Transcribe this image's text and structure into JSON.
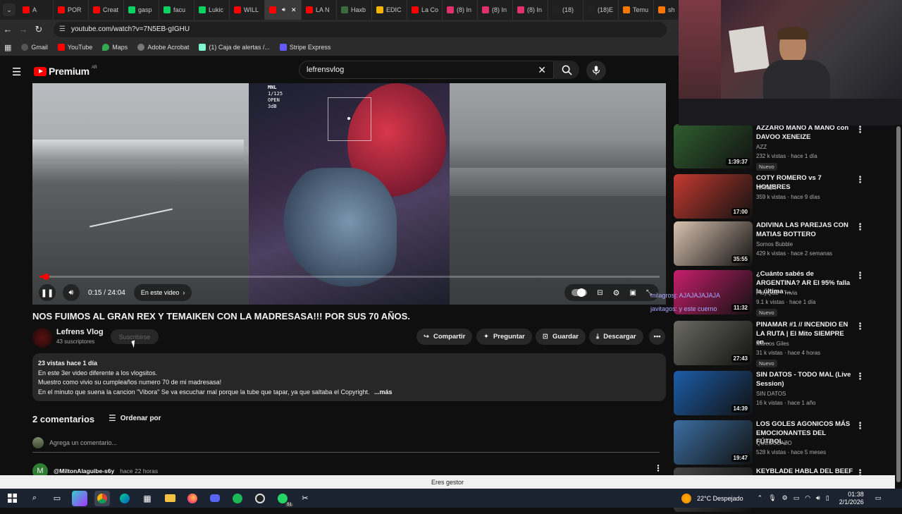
{
  "tabs": [
    {
      "label": "A",
      "color": "#ff0000"
    },
    {
      "label": "POR",
      "color": "#ff0000"
    },
    {
      "label": "Creat",
      "color": "#ff0000"
    },
    {
      "label": "gasp",
      "color": "#0bd160"
    },
    {
      "label": "facu",
      "color": "#0bd160"
    },
    {
      "label": "Lukic",
      "color": "#0bd160"
    },
    {
      "label": "WILL",
      "color": "#ff0000"
    },
    {
      "label": "",
      "color": "#ff0000",
      "active": true
    },
    {
      "label": "LA N",
      "color": "#ff0000"
    },
    {
      "label": "Haxb",
      "color": "#3a6b3a"
    },
    {
      "label": "EDIC",
      "color": "#f4b400"
    },
    {
      "label": "La Co",
      "color": "#ff0000"
    },
    {
      "label": "(8) In",
      "color": "#e1306c"
    },
    {
      "label": "(8) In",
      "color": "#e1306c"
    },
    {
      "label": "(8) In",
      "color": "#e1306c"
    },
    {
      "label": "(18)",
      "color": "#222222"
    },
    {
      "label": "(18)E",
      "color": "#222222"
    },
    {
      "label": "Temu",
      "color": "#fb7701"
    },
    {
      "label": "sh",
      "color": "#fb7701"
    }
  ],
  "url": "youtube.com/watch?v=7N5EB-gIGHU",
  "bookmarks": [
    "Gmail",
    "YouTube",
    "Maps",
    "Adobe Acrobat",
    "(1) Caja de alertas /...",
    "Stripe Express"
  ],
  "header": {
    "logo_text": "Premium",
    "region": "AR",
    "search_value": "lefrensvlog"
  },
  "video": {
    "time": "0:15 / 24:04",
    "chapter_chip": "En este video",
    "progress": 0.0104,
    "osd_lines": [
      "MNL",
      "1/125",
      "OPEN",
      "3dB"
    ]
  },
  "title": "NOS FUIMOS AL GRAN REX Y TEMAIKEN CON LA MADRESASA!!! POR SUS 70 AÑOS.",
  "channel": {
    "name": "Lefrens Vlog",
    "subs": "43 suscriptores",
    "subscribe": "Suscribirse"
  },
  "actions": {
    "share": "Compartir",
    "ask": "Preguntar",
    "save": "Guardar",
    "download": "Descargar"
  },
  "description": {
    "stats": "23 vistas  hace 1 día",
    "line1": "En este 3er video diferente a los vlogsitos.",
    "line2": "Muestro como vivio su cumpleaños numero 70 de mi madresasa!",
    "line3": "En el minuto que suena la cancion \"Vibora\" Se va escuchar mal porque la tube que tapar, ya que saltaba el Copyright.",
    "more": "...más"
  },
  "comments": {
    "count": "2 comentarios",
    "sort": "Ordenar por",
    "placeholder": "Agrega un comentario...",
    "first_user": "@MiltonAlaguibe-s6y",
    "first_time": "hace 22 horas",
    "first_avatar": "M"
  },
  "recommendations": [
    {
      "title": "AZZARO MANO A MANO con DAVOO XENEIZE",
      "channel": "AZZ",
      "meta": "232 k vistas · hace 1 día",
      "duration": "1:39:37",
      "badge": "Nuevo",
      "thumb": "#2f5e2f"
    },
    {
      "title": "COTY ROMERO vs 7 HOMBRES",
      "channel": "WANDII",
      "meta": "359 k vistas · hace 9 días",
      "duration": "17:00",
      "badge": "",
      "thumb": "#c33a2f"
    },
    {
      "title": "ADIVINA LAS PAREJAS CON MATIAS BOTTERO",
      "channel": "Somos Bubble",
      "meta": "429 k vistas · hace 2 semanas",
      "duration": "35:55",
      "badge": "",
      "thumb": "#d9c3b0"
    },
    {
      "title": "¿Cuánto sabés de ARGENTINA? AR El 95% falla la última ...",
      "channel": "PlayQuiz - Trivia",
      "meta": "9.1 k vistas · hace 1 día",
      "duration": "11:32",
      "badge": "Nuevo",
      "thumb": "#c71e6b"
    },
    {
      "title": "PINAMAR #1 // INCENDIO EN LA RUTA | El Mito SIEMPRE en...",
      "channel": "Marcos Giles",
      "meta": "31 k vistas · hace 4 horas",
      "duration": "27:43",
      "badge": "Nuevo",
      "thumb": "#6a6a62"
    },
    {
      "title": "SIN DATOS - TODO MAL (Live Session)",
      "channel": "SIN DATOS",
      "meta": "16 k vistas · hace 1 año",
      "duration": "14:39",
      "badge": "",
      "thumb": "#1d5da8"
    },
    {
      "title": "LOS GOLES AGONICOS MÁS EMOCIONANTES DEL FÚTBOL...",
      "channel": "QUEGOLAZO",
      "meta": "528 k vistas · hace 5 meses",
      "duration": "19:47",
      "badge": "",
      "thumb": "#3b6ea0"
    },
    {
      "title": "KEYBLADE HABLA DEL BEEF",
      "channel": "",
      "meta": "",
      "duration": "",
      "badge": "",
      "thumb": "#444444"
    }
  ],
  "overlay": {
    "line1": "milagrosj: AJAJAJAJAJA",
    "line2": "javitagos: y este cuerno"
  },
  "status_strip": "Eres gestor",
  "taskbar": {
    "weather": "22°C  Despejado",
    "time": "01:38",
    "date": "2/1/2026",
    "whatsapp_badge": "51"
  }
}
